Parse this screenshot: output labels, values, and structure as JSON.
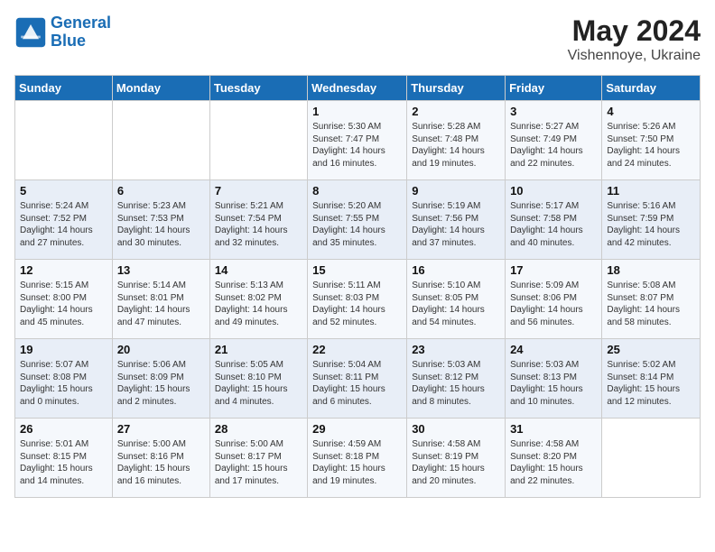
{
  "header": {
    "logo_line1": "General",
    "logo_line2": "Blue",
    "month_year": "May 2024",
    "location": "Vishennoye, Ukraine"
  },
  "weekdays": [
    "Sunday",
    "Monday",
    "Tuesday",
    "Wednesday",
    "Thursday",
    "Friday",
    "Saturday"
  ],
  "weeks": [
    [
      {
        "day": "",
        "info": ""
      },
      {
        "day": "",
        "info": ""
      },
      {
        "day": "",
        "info": ""
      },
      {
        "day": "1",
        "info": "Sunrise: 5:30 AM\nSunset: 7:47 PM\nDaylight: 14 hours\nand 16 minutes."
      },
      {
        "day": "2",
        "info": "Sunrise: 5:28 AM\nSunset: 7:48 PM\nDaylight: 14 hours\nand 19 minutes."
      },
      {
        "day": "3",
        "info": "Sunrise: 5:27 AM\nSunset: 7:49 PM\nDaylight: 14 hours\nand 22 minutes."
      },
      {
        "day": "4",
        "info": "Sunrise: 5:26 AM\nSunset: 7:50 PM\nDaylight: 14 hours\nand 24 minutes."
      }
    ],
    [
      {
        "day": "5",
        "info": "Sunrise: 5:24 AM\nSunset: 7:52 PM\nDaylight: 14 hours\nand 27 minutes."
      },
      {
        "day": "6",
        "info": "Sunrise: 5:23 AM\nSunset: 7:53 PM\nDaylight: 14 hours\nand 30 minutes."
      },
      {
        "day": "7",
        "info": "Sunrise: 5:21 AM\nSunset: 7:54 PM\nDaylight: 14 hours\nand 32 minutes."
      },
      {
        "day": "8",
        "info": "Sunrise: 5:20 AM\nSunset: 7:55 PM\nDaylight: 14 hours\nand 35 minutes."
      },
      {
        "day": "9",
        "info": "Sunrise: 5:19 AM\nSunset: 7:56 PM\nDaylight: 14 hours\nand 37 minutes."
      },
      {
        "day": "10",
        "info": "Sunrise: 5:17 AM\nSunset: 7:58 PM\nDaylight: 14 hours\nand 40 minutes."
      },
      {
        "day": "11",
        "info": "Sunrise: 5:16 AM\nSunset: 7:59 PM\nDaylight: 14 hours\nand 42 minutes."
      }
    ],
    [
      {
        "day": "12",
        "info": "Sunrise: 5:15 AM\nSunset: 8:00 PM\nDaylight: 14 hours\nand 45 minutes."
      },
      {
        "day": "13",
        "info": "Sunrise: 5:14 AM\nSunset: 8:01 PM\nDaylight: 14 hours\nand 47 minutes."
      },
      {
        "day": "14",
        "info": "Sunrise: 5:13 AM\nSunset: 8:02 PM\nDaylight: 14 hours\nand 49 minutes."
      },
      {
        "day": "15",
        "info": "Sunrise: 5:11 AM\nSunset: 8:03 PM\nDaylight: 14 hours\nand 52 minutes."
      },
      {
        "day": "16",
        "info": "Sunrise: 5:10 AM\nSunset: 8:05 PM\nDaylight: 14 hours\nand 54 minutes."
      },
      {
        "day": "17",
        "info": "Sunrise: 5:09 AM\nSunset: 8:06 PM\nDaylight: 14 hours\nand 56 minutes."
      },
      {
        "day": "18",
        "info": "Sunrise: 5:08 AM\nSunset: 8:07 PM\nDaylight: 14 hours\nand 58 minutes."
      }
    ],
    [
      {
        "day": "19",
        "info": "Sunrise: 5:07 AM\nSunset: 8:08 PM\nDaylight: 15 hours\nand 0 minutes."
      },
      {
        "day": "20",
        "info": "Sunrise: 5:06 AM\nSunset: 8:09 PM\nDaylight: 15 hours\nand 2 minutes."
      },
      {
        "day": "21",
        "info": "Sunrise: 5:05 AM\nSunset: 8:10 PM\nDaylight: 15 hours\nand 4 minutes."
      },
      {
        "day": "22",
        "info": "Sunrise: 5:04 AM\nSunset: 8:11 PM\nDaylight: 15 hours\nand 6 minutes."
      },
      {
        "day": "23",
        "info": "Sunrise: 5:03 AM\nSunset: 8:12 PM\nDaylight: 15 hours\nand 8 minutes."
      },
      {
        "day": "24",
        "info": "Sunrise: 5:03 AM\nSunset: 8:13 PM\nDaylight: 15 hours\nand 10 minutes."
      },
      {
        "day": "25",
        "info": "Sunrise: 5:02 AM\nSunset: 8:14 PM\nDaylight: 15 hours\nand 12 minutes."
      }
    ],
    [
      {
        "day": "26",
        "info": "Sunrise: 5:01 AM\nSunset: 8:15 PM\nDaylight: 15 hours\nand 14 minutes."
      },
      {
        "day": "27",
        "info": "Sunrise: 5:00 AM\nSunset: 8:16 PM\nDaylight: 15 hours\nand 16 minutes."
      },
      {
        "day": "28",
        "info": "Sunrise: 5:00 AM\nSunset: 8:17 PM\nDaylight: 15 hours\nand 17 minutes."
      },
      {
        "day": "29",
        "info": "Sunrise: 4:59 AM\nSunset: 8:18 PM\nDaylight: 15 hours\nand 19 minutes."
      },
      {
        "day": "30",
        "info": "Sunrise: 4:58 AM\nSunset: 8:19 PM\nDaylight: 15 hours\nand 20 minutes."
      },
      {
        "day": "31",
        "info": "Sunrise: 4:58 AM\nSunset: 8:20 PM\nDaylight: 15 hours\nand 22 minutes."
      },
      {
        "day": "",
        "info": ""
      }
    ]
  ]
}
